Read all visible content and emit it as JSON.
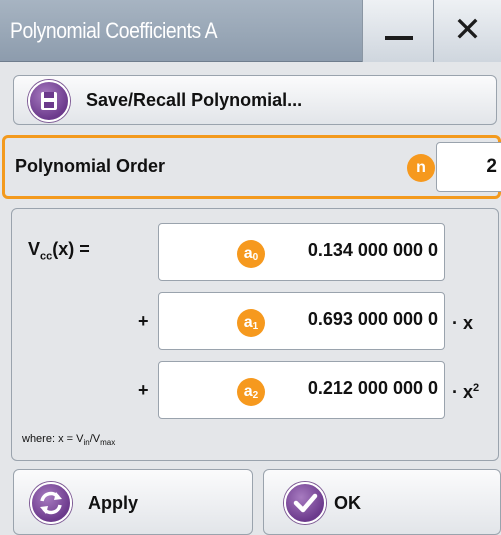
{
  "window": {
    "title": "Polynomial Coefficients A",
    "minimize_glyph": "minimize",
    "close_glyph": "✕"
  },
  "save_recall": {
    "label": "Save/Recall Polynomial...",
    "icon": "floppy-disk-icon"
  },
  "order": {
    "label": "Polynomial Order",
    "badge": "n",
    "value": "2"
  },
  "formula": {
    "lhs_main": "V",
    "lhs_sub": "cc",
    "lhs_tail": "(x) =",
    "plus": "+",
    "coefficients": [
      {
        "badge": "a",
        "badge_sub": "0",
        "value": "0.134 000 000 0",
        "suffix": "",
        "suffix_sup": ""
      },
      {
        "badge": "a",
        "badge_sub": "1",
        "value": "0.693 000 000 0",
        "suffix": "· x",
        "suffix_sup": ""
      },
      {
        "badge": "a",
        "badge_sub": "2",
        "value": "0.212 000 000 0",
        "suffix": "· x",
        "suffix_sup": "2"
      }
    ],
    "where": {
      "prefix": "where: x = V",
      "sub1": "in",
      "mid": "/V",
      "sub2": "max"
    }
  },
  "buttons": {
    "apply": {
      "label": "Apply",
      "icon": "refresh-icon"
    },
    "ok": {
      "label": "OK",
      "icon": "checkmark-icon"
    }
  },
  "colors": {
    "accent_orange": "#f6991e",
    "icon_purple": "#6c3a8c",
    "titlebar": "#9aa8b8"
  }
}
